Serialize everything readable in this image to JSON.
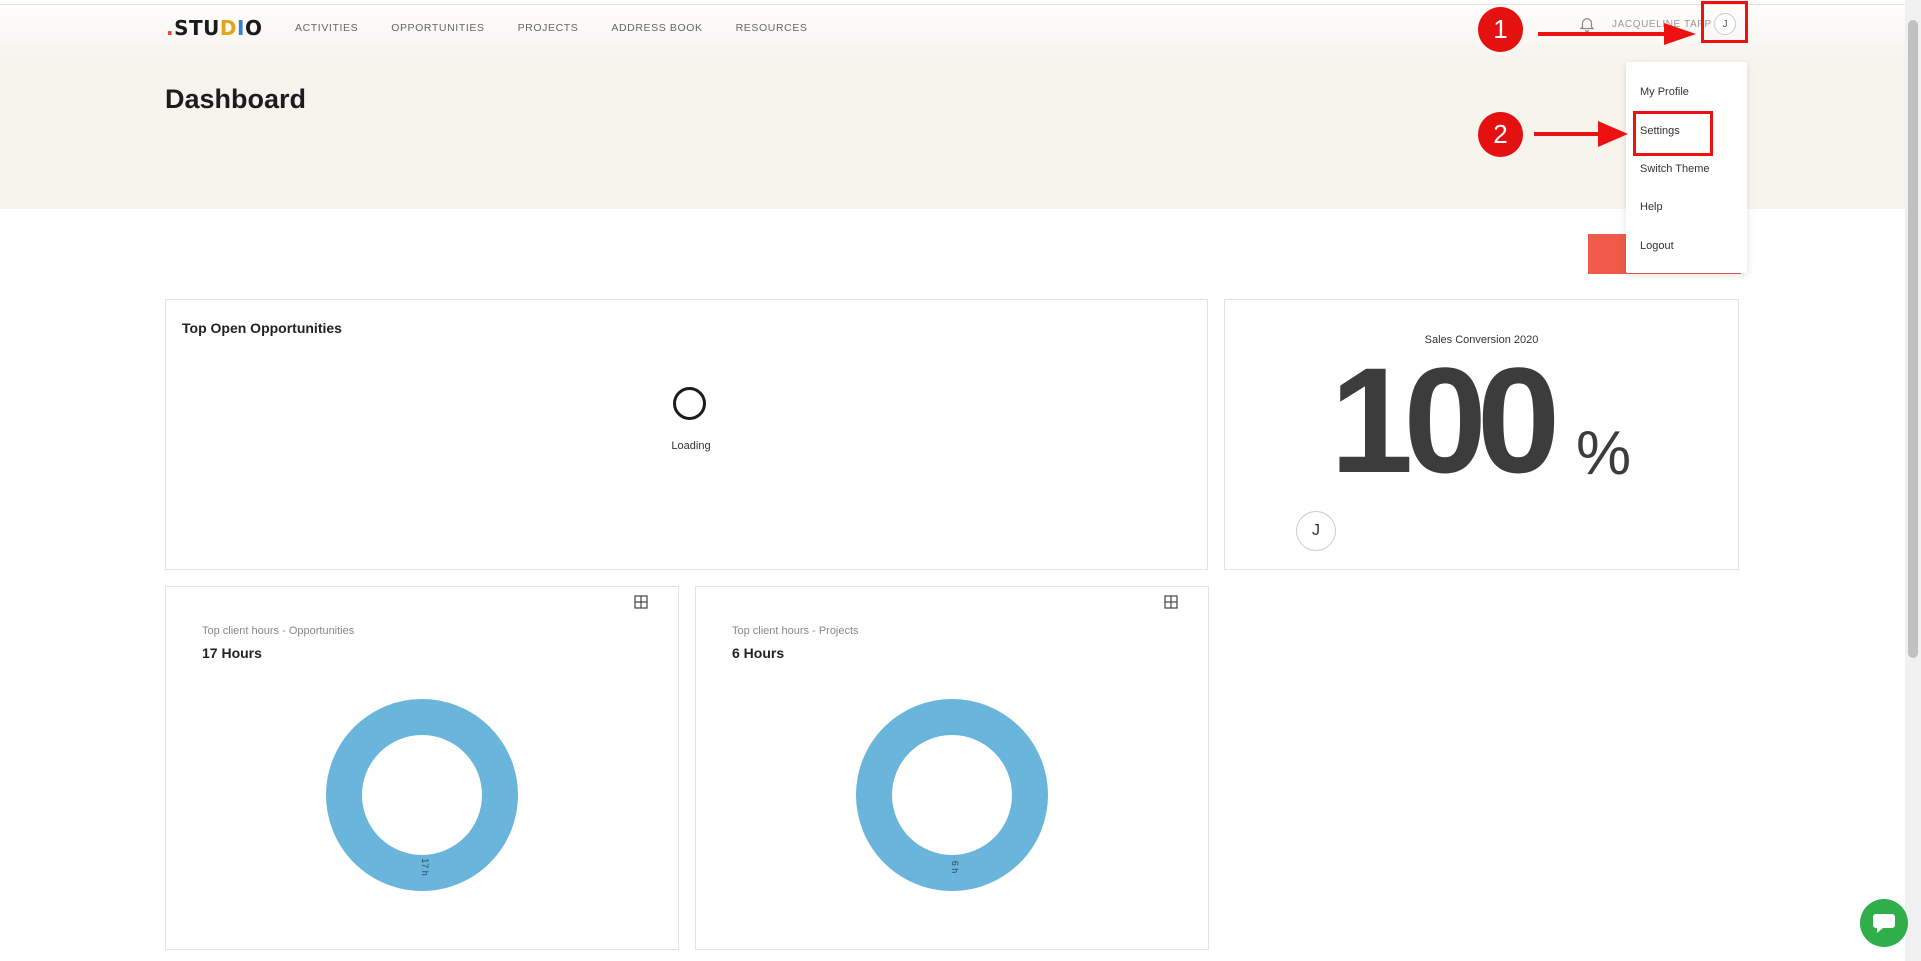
{
  "header": {
    "logo": {
      "dot": ".",
      "s": "ST",
      "u": "U",
      "d": "D",
      "i": "I",
      "o": "O"
    },
    "nav": [
      "ACTIVITIES",
      "OPPORTUNITIES",
      "PROJECTS",
      "ADDRESS BOOK",
      "RESOURCES"
    ],
    "username": "JACQUELINE TAPP",
    "avatar_initial": "J"
  },
  "page": {
    "title": "Dashboard"
  },
  "cards": {
    "top_open_opportunities": {
      "title": "Top Open Opportunities",
      "loading_text": "Loading"
    },
    "sales_conversion": {
      "title": "Sales Conversion 2020",
      "value": "100",
      "unit": "%",
      "avatar_initial": "J"
    },
    "client_hours_opportunities": {
      "subtitle": "Top client hours - Opportunities",
      "total": "17 Hours",
      "segment_label": "17 h",
      "segments": [
        {
          "value": 17,
          "color": "#69b5db"
        }
      ]
    },
    "client_hours_projects": {
      "subtitle": "Top client hours - Projects",
      "total": "6 Hours",
      "segment_label": "6 h",
      "segments": [
        {
          "value": 6,
          "color": "#69b5db"
        }
      ]
    }
  },
  "user_menu": [
    "My Profile",
    "Settings",
    "Switch Theme",
    "Help",
    "Logout"
  ],
  "annotations": {
    "step1": "1",
    "step2": "2"
  },
  "colors": {
    "accent_red": "#ef5a4a",
    "donut": "#69b5db",
    "chat": "#2fae4b",
    "annotation": "#e51010"
  }
}
